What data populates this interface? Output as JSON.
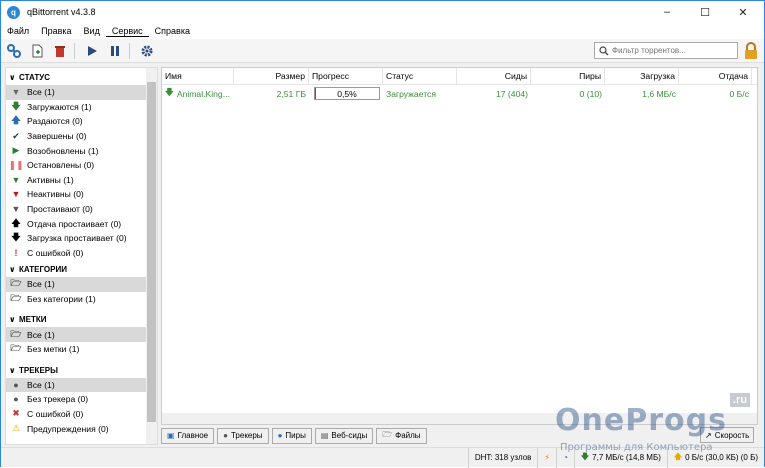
{
  "window": {
    "title": "qBittorrent v4.3.8"
  },
  "menu": [
    "Файл",
    "Правка",
    "Вид",
    "Сервис",
    "Справка"
  ],
  "filter": {
    "placeholder": "Фильтр торрентов..."
  },
  "sidebar": {
    "status": {
      "heading": "СТАТУС",
      "items": [
        {
          "label": "Все (1)",
          "icon": "filter-icon"
        },
        {
          "label": "Загружаются (1)",
          "icon": "download-arrow-icon"
        },
        {
          "label": "Раздаются (0)",
          "icon": "upload-arrow-icon"
        },
        {
          "label": "Завершены (0)",
          "icon": "checkmark-icon"
        },
        {
          "label": "Возобновлены (1)",
          "icon": "play-icon"
        },
        {
          "label": "Остановлены (0)",
          "icon": "pause-icon"
        },
        {
          "label": "Активны (1)",
          "icon": "filter-icon"
        },
        {
          "label": "Неактивны (0)",
          "icon": "filter-icon"
        },
        {
          "label": "Простаивают (0)",
          "icon": "filter-icon"
        },
        {
          "label": "Отдача простаивает (0)",
          "icon": "upload-arrow-icon"
        },
        {
          "label": "Загрузка простаивает (0)",
          "icon": "download-arrow-icon"
        },
        {
          "label": "С ошибкой (0)",
          "icon": "error-icon"
        }
      ]
    },
    "categories": {
      "heading": "КАТЕГОРИИ",
      "items": [
        {
          "label": "Все (1)",
          "icon": "folder-icon"
        },
        {
          "label": "Без категории (1)",
          "icon": "folder-icon"
        }
      ]
    },
    "tags": {
      "heading": "МЕТКИ",
      "items": [
        {
          "label": "Все (1)",
          "icon": "folder-icon"
        },
        {
          "label": "Без метки (1)",
          "icon": "folder-icon"
        }
      ]
    },
    "trackers": {
      "heading": "ТРЕКЕРЫ",
      "items": [
        {
          "label": "Все (1)",
          "icon": "tracker-icon"
        },
        {
          "label": "Без трекера (0)",
          "icon": "tracker-icon"
        },
        {
          "label": "С ошибкой (0)",
          "icon": "error-circle-icon"
        },
        {
          "label": "Предупреждения (0)",
          "icon": "warning-icon"
        }
      ]
    }
  },
  "table": {
    "columns": [
      "Имя",
      "Размер",
      "Прогресс",
      "Статус",
      "Сиды",
      "Пиры",
      "Загрузка",
      "Отдача"
    ],
    "rows": [
      {
        "name": "Animal.King...",
        "size": "2,51 ГБ",
        "progress": "0,5%",
        "progress_value": 0.005,
        "status": "Загружается",
        "seeds": "17 (404)",
        "peers": "0 (10)",
        "down": "1,6 МБ/с",
        "up": "0 Б/с"
      }
    ]
  },
  "tabs": [
    "Главное",
    "Трекеры",
    "Пиры",
    "Веб-сиды",
    "Файлы"
  ],
  "speed_button": "Скорость",
  "statusbar": {
    "dht": "DHT: 318 узлов",
    "download": "7,7 МБ/с (14,8 МБ)",
    "upload": "0 Б/с (30,0 КБ) (0 Б)"
  },
  "watermark": {
    "brand": "OneProgs",
    "tld": ".ru",
    "tagline": "Программы для Компьютера"
  },
  "colors": {
    "accent": "#2b88d8",
    "downloading": "#3a8f3a",
    "selection": "#d9d9d9"
  }
}
